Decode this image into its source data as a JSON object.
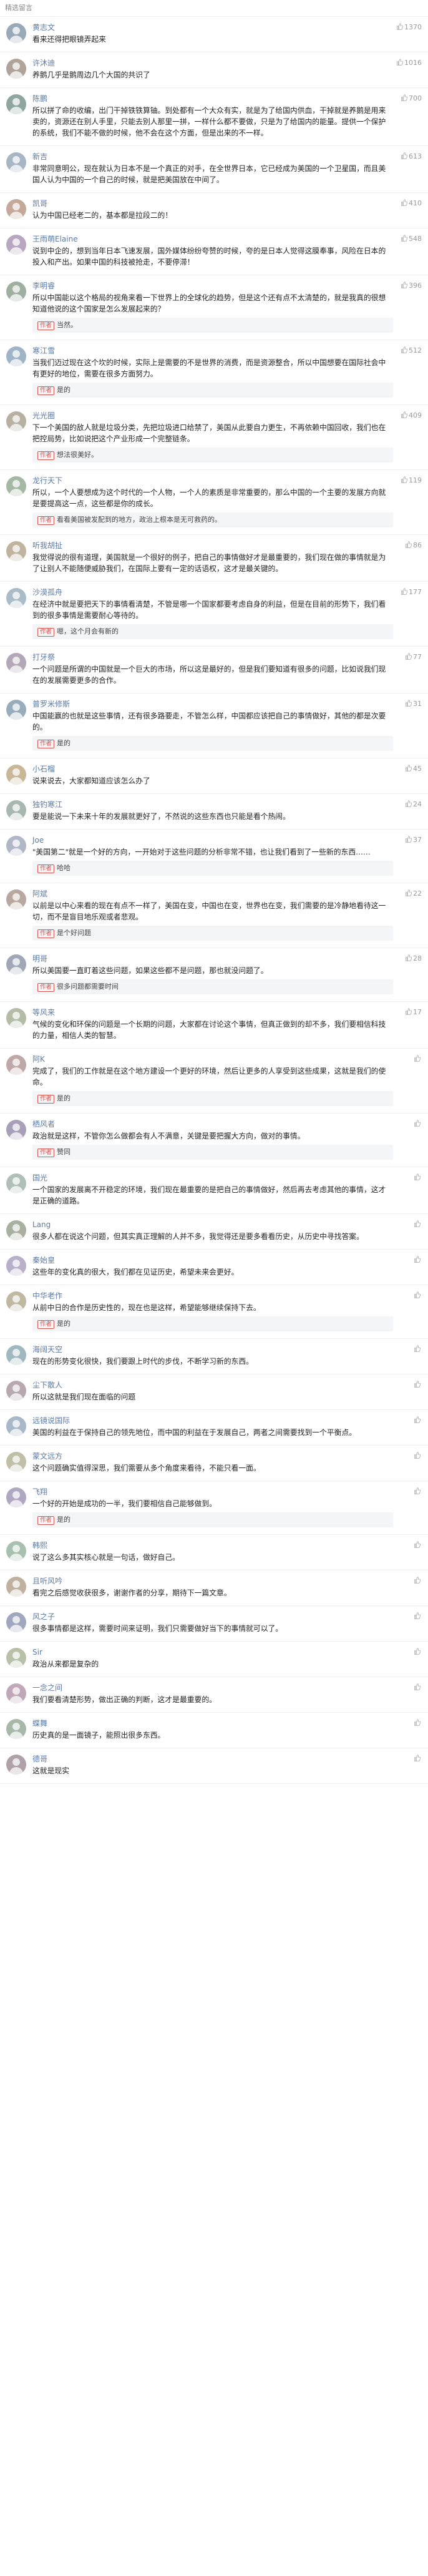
{
  "header": {
    "title": "精选留言"
  },
  "comments": [
    {
      "name": "黄志文",
      "likes": "1370",
      "text": "看来还得把眼镜弄起来",
      "color": "#9aa9b8"
    },
    {
      "name": "许沐迪",
      "likes": "1016",
      "text": "养鹅几乎是鹅周边几个大国的共识了",
      "color": "#b0a49a"
    },
    {
      "name": "陈鹏",
      "likes": "700",
      "text": "所以拼了命的收编，出门干掉铁铁算铀。到处都有一个大众有实，就是为了给国内供血，干掉就是养鹅是用来卖的，资源还在别人手里，只能去别人那里一拼，一样什么都不要做，只是为了给国内的能量。提供一个保护的系统，我们不能不做的时候，他不会在这个方面，但是出来的不一样。",
      "color": "#8fa6a0"
    },
    {
      "name": "新吉",
      "likes": "613",
      "text": "非常同意明公，现在就认为日本不是一个真正的对手，在全世界日本，它已经成为美国的一个卫星国，而且美国人认为中国的一个自己的时候，就是把美国放在中间了。",
      "color": "#a8b5c4"
    },
    {
      "name": "凯哥",
      "likes": "410",
      "text": "认为中国已经老二的，基本都是拉段二的！",
      "color": "#c4a898"
    },
    {
      "name": "王雨萌Elaine",
      "likes": "548",
      "text": "说到中企的，想到当年日本飞速发展，国外媒体纷纷夸赞的时候，夸的是日本人觉得这膜奉事，风险在日本的投入和产出。如果中国的科技被抢走，不要停滞！",
      "color": "#b9a6c0"
    },
    {
      "name": "李明睿",
      "likes": "396",
      "text": "所以中国能以这个格局的视角来看一下世界上的全球化的趋势，但是这个还有点不太清楚的，就是我真的很想知道他说的这个国家是怎么发展起来的？",
      "reply_author": "作者",
      "reply_text": "当然。",
      "color": "#9fb0a0"
    },
    {
      "name": "寒江雪",
      "likes": "512",
      "text": "当我们迈过现在这个坎的时候，实际上是需要的不是世界的消费，而是资源整合，所以中国想要在国际社会中有更好的地位，需要在很多方面努力。",
      "reply_author": "作者",
      "reply_text": "是的",
      "color": "#a0b4c8"
    },
    {
      "name": "光光圈",
      "likes": "409",
      "text": "下一个美国的敌人就是垃圾分类，先把垃圾进口给禁了，美国从此要自力更生，不再依赖中国回收，我们也在把控局势，比如说把这个产业形成一个完整链条。",
      "reply_author": "作者",
      "reply_text": "想法很美好。",
      "color": "#b8b0a0"
    },
    {
      "name": "龙行天下",
      "likes": "119",
      "text": "所以，一个人要想成为这个时代的一个人物，一个人的素质是非常重要的，那么中国的一个主要的发展方向就是要提高这一点，这些都是你的成长。",
      "reply_author": "作者",
      "reply_text": "看看美国被发配到的地方，政治上根本是无可救药的。",
      "color": "#a4b8a4"
    },
    {
      "name": "听我胡扯",
      "likes": "86",
      "text": "我觉得说的很有道理，美国就是一个很好的例子，把自己的事情做好才是最重要的，我们现在做的事情就是为了让别人不能随便威胁我们，在国际上要有一定的话语权，这才是最关键的。",
      "color": "#c0b4a0"
    },
    {
      "name": "沙漠孤舟",
      "likes": "177",
      "text": "在经济中就是要把天下的事情看清楚，不管是哪一个国家都要考虑自身的利益，但是在目前的形势下，我们看到的很多事情是需要耐心等待的。",
      "reply_author": "作者",
      "reply_text": "嗯，这个月会有新的",
      "color": "#a9bcc8"
    },
    {
      "name": "打牙祭",
      "likes": "77",
      "text": "一个问题是所谓的中国就是一个巨大的市场，所以这是最好的，但是我们要知道有很多的问题，比如说我们现在的发展需要更多的合作。",
      "color": "#b4a8b8"
    },
    {
      "name": "普罗米修斯",
      "likes": "31",
      "text": "中国能赢的也就是这些事情，还有很多路要走，不管怎么样，中国都应该把自己的事情做好，其他的都是次要的。",
      "reply_author": "作者",
      "reply_text": "是的",
      "color": "#98acbc"
    },
    {
      "name": "小石榴",
      "likes": "45",
      "text": "说来说去，大家都知道应该怎么办了",
      "color": "#c8b898"
    },
    {
      "name": "独钓寒江",
      "likes": "24",
      "text": "要是能说一下未来十年的发展就更好了，不然说的这些东西也只能是看个热闹。",
      "color": "#a8b8b0"
    },
    {
      "name": "Joe",
      "likes": "37",
      "text": "\"美国第二\"就是一个好的方向，一开始对于这些问题的分析非常不错，也让我们看到了一些新的东西……",
      "reply_author": "作者",
      "reply_text": "哈哈",
      "color": "#b0b8c8"
    },
    {
      "name": "阿斌",
      "likes": "22",
      "text": "以前是以中心来看的现在有点不一样了，美国在变，中国也在变，世界也在变，我们需要的是冷静地看待这一切，而不是盲目地乐观或者悲观。",
      "reply_author": "作者",
      "reply_text": "是个好问题",
      "color": "#b8a8a0"
    },
    {
      "name": "明哥",
      "likes": "28",
      "text": "所以美国要一直盯着这些问题，如果这些都不是问题，那也就没问题了。",
      "reply_author": "作者",
      "reply_text": "很多问题都需要时间",
      "color": "#a0a8b8"
    },
    {
      "name": "等风来",
      "likes": "17",
      "text": "气候的变化和环保的问题是一个长期的问题，大家都在讨论这个事情，但真正做到的却不多，我们要相信科技的力量，相信人类的智慧。",
      "color": "#b4bca8"
    },
    {
      "name": "阿K",
      "likes": "",
      "text": "完成了，我们的工作就是在这个地方建设一个更好的环境，然后让更多的人享受到这些成果，这就是我们的使命。",
      "reply_author": "作者",
      "reply_text": "是的",
      "color": "#c0a8a8"
    },
    {
      "name": "栖风者",
      "likes": "",
      "text": "政治就是这样，不管你怎么做都会有人不满意，关键是要把握大方向，做对的事情。",
      "reply_author": "作者",
      "reply_text": "赞同",
      "color": "#a8a0b8"
    },
    {
      "name": "国光",
      "likes": "",
      "text": "一个国家的发展离不开稳定的环境，我们现在最重要的是把自己的事情做好，然后再去考虑其他的事情，这才是正确的道路。",
      "color": "#b0c0b8"
    },
    {
      "name": "Lang",
      "likes": "",
      "text": "很多人都在说这个问题，但其实真正理解的人并不多，我觉得还是要多看看历史，从历史中寻找答案。",
      "color": "#a8b0a0"
    },
    {
      "name": "秦始皇",
      "likes": "",
      "text": "这些年的变化真的很大，我们都在见证历史，希望未来会更好。",
      "color": "#b8b0c8"
    },
    {
      "name": "中华老作",
      "likes": "",
      "text": "从前中日的合作是历史性的，现在也是这样，希望能够继续保持下去。",
      "reply_author": "作者",
      "reply_text": "是的",
      "color": "#c0b8a0"
    },
    {
      "name": "海阔天空",
      "likes": "",
      "text": "现在的形势变化很快，我们要跟上时代的步伐，不断学习新的东西。",
      "color": "#a0b8c0"
    },
    {
      "name": "尘下散人",
      "likes": "",
      "text": "所以这就是我们现在面临的问题",
      "color": "#b8a8b0"
    },
    {
      "name": "远镜说国际",
      "likes": "",
      "text": "美国的利益在于保持自己的领先地位，而中国的利益在于发展自己，两者之间需要找到一个平衡点。",
      "color": "#a8b8c8"
    },
    {
      "name": "蒙文远方",
      "likes": "",
      "text": "这个问题确实值得深思，我们需要从多个角度来看待，不能只看一面。",
      "color": "#c0c0a8"
    },
    {
      "name": "飞翔",
      "likes": "",
      "text": "一个好的开始是成功的一半，我们要相信自己能够做到。",
      "reply_author": "作者",
      "reply_text": "是的",
      "color": "#b0a8c0"
    },
    {
      "name": "韩熙",
      "likes": "",
      "text": "说了这么多其实核心就是一句话，做好自己。",
      "color": "#a8c0b0"
    },
    {
      "name": "且听风吟",
      "likes": "",
      "text": "看完之后感觉收获很多，谢谢作者的分享，期待下一篇文章。",
      "color": "#c0b0a0"
    },
    {
      "name": "风之子",
      "likes": "",
      "text": "很多事情都是这样，需要时间来证明，我们只需要做好当下的事情就可以了。",
      "color": "#a0a8c0"
    },
    {
      "name": "Sir",
      "likes": "",
      "text": "政治从来都是复杂的",
      "color": "#b8c0a8"
    },
    {
      "name": "一念之间",
      "likes": "",
      "text": "我们要看清楚形势，做出正确的判断，这才是最重要的。",
      "color": "#c0a8b8"
    },
    {
      "name": "蝶舞",
      "likes": "",
      "text": "历史真的是一面镜子，能照出很多东西。",
      "color": "#a8b8a8"
    },
    {
      "name": "德哥",
      "likes": "",
      "text": "这就是现实",
      "color": "#b0a0a8"
    }
  ]
}
